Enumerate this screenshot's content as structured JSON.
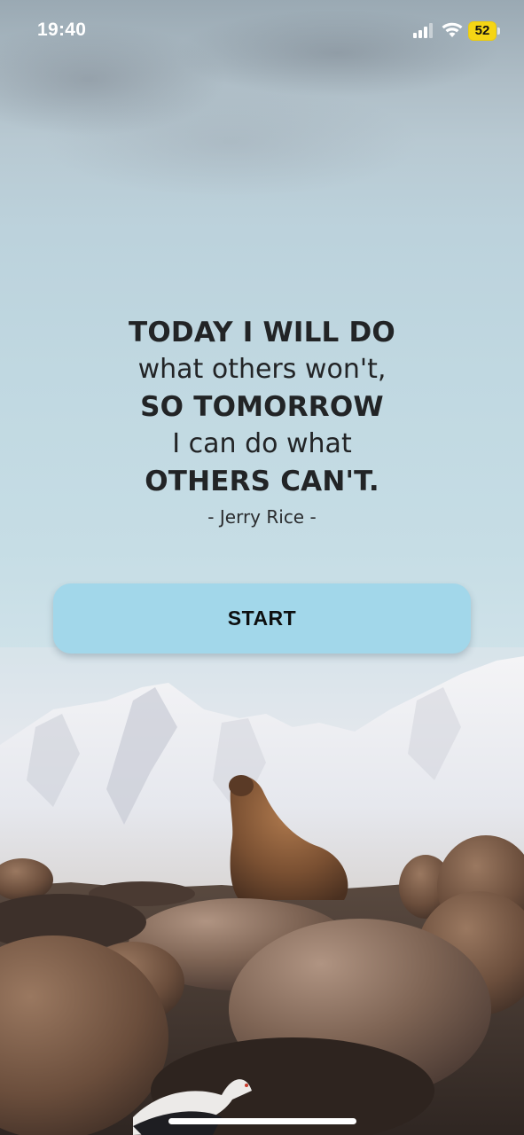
{
  "status_bar": {
    "time": "19:40",
    "battery_level": "52",
    "signal_icon": "cellular-signal-icon",
    "wifi_icon": "wifi-icon",
    "battery_color": "#f5d515"
  },
  "quote": {
    "line1": "TODAY I WILL DO",
    "line2": "what others won't,",
    "line3": "SO TOMORROW",
    "line4": "I can do what",
    "line5": "OTHERS CAN'T.",
    "author": "- Jerry Rice -"
  },
  "start_button": {
    "label": "START",
    "color": "#a2d7ea"
  }
}
